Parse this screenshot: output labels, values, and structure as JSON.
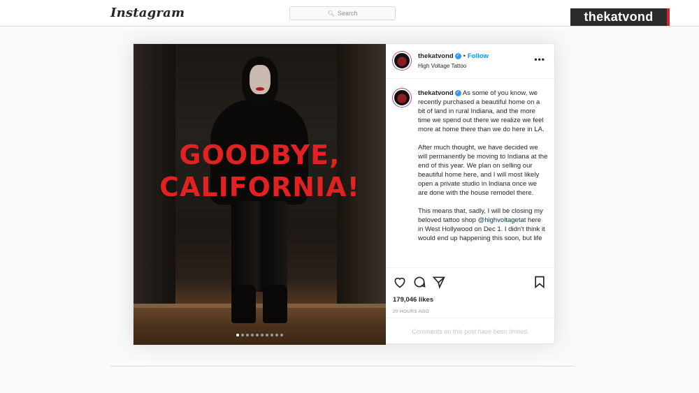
{
  "nav": {
    "logo": "Instagram",
    "search_placeholder": "Search"
  },
  "overlay": {
    "handle": "thekatvond",
    "accent_color": "#d3202a"
  },
  "post": {
    "author": "thekatvond",
    "separator": "•",
    "follow_label": "Follow",
    "location": "High Voltage Tattoo",
    "more_label": "•••",
    "image_text_line1": "GOODBYE,",
    "image_text_line2": "CALIFORNIA!",
    "carousel_total": 10,
    "carousel_index": 1,
    "caption": {
      "author": "thekatvond",
      "paragraph1": "As some of you know, we recently purchased a beautiful home on a bit of land in rural Indiana, and the more time we spend out there we realize we feel more at home there than we do here in LA.",
      "paragraph2": "After much thought, we have decided we will permanently be moving to Indiana at the end of this year. We plan on selling our beautiful home here, and I will most likely open a private studio in Indiana once we are done with the house remodel there.",
      "paragraph3_before": "This means that, sadly, I will be closing my beloved tattoo shop",
      "paragraph3_mention": "@highvoltagetat",
      "paragraph3_after": "here in West Hollywood on Dec 1. I didn't think it would end up happening this soon, but life"
    },
    "likes": "179,046 likes",
    "timestamp": "20 HOURS AGO",
    "comments_limited": "Comments on this post have been limited.",
    "icons": [
      "heart-icon",
      "comment-icon",
      "share-icon",
      "bookmark-icon"
    ]
  }
}
